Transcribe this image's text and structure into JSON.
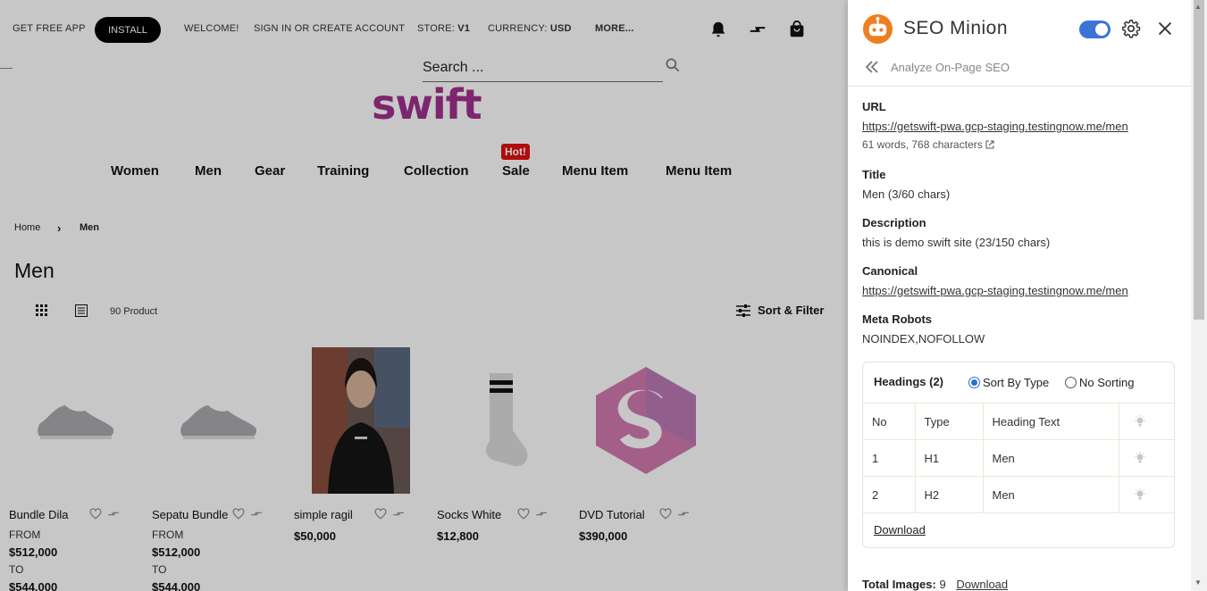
{
  "topbar": {
    "get_app": "GET FREE APP",
    "install": "INSTALL",
    "welcome": "WELCOME!",
    "signin": "SIGN IN OR CREATE ACCOUNT",
    "store_label": "STORE:",
    "store_value": "V1",
    "currency_label": "CURRENCY:",
    "currency_value": "USD",
    "more": "MORE..."
  },
  "search": {
    "placeholder": "Search ..."
  },
  "logo": "swift",
  "nav": {
    "items": [
      "Women",
      "Men",
      "Gear",
      "Training",
      "Collection",
      "Sale",
      "Menu Item",
      "Menu Item"
    ],
    "hot_badge": "Hot!"
  },
  "breadcrumb": {
    "home": "Home",
    "current": "Men"
  },
  "page_title": "Men",
  "toolbar": {
    "count": "90 Product",
    "sort_filter": "Sort & Filter"
  },
  "products": [
    {
      "name": "Bundle Dila",
      "from": "FROM",
      "price": "$512,000",
      "to": "TO",
      "price_to": "$544,000"
    },
    {
      "name": "Sepatu Bundle",
      "from": "FROM",
      "price": "$512,000",
      "to": "TO",
      "price_to": "$544,000"
    },
    {
      "name": "simple ragil",
      "price": "$50,000"
    },
    {
      "name": "Socks White",
      "price": "$12,800"
    },
    {
      "name": "DVD Tutorial",
      "price": "$390,000"
    }
  ],
  "panel": {
    "title": "SEO Minion",
    "subtitle": "Analyze On-Page SEO",
    "url_label": "URL",
    "url": "https://getswift-pwa.gcp-staging.testingnow.me/men",
    "url_stats": "61 words, 768 characters",
    "title_label": "Title",
    "title_value": "Men (3/60 chars)",
    "desc_label": "Description",
    "desc_value": "this is demo swift site (23/150 chars)",
    "canonical_label": "Canonical",
    "canonical": "https://getswift-pwa.gcp-staging.testingnow.me/men",
    "robots_label": "Meta Robots",
    "robots_value": "NOINDEX,NOFOLLOW",
    "headings": {
      "title": "Headings (2)",
      "sort_by_type": "Sort By Type",
      "no_sorting": "No Sorting",
      "columns": [
        "No",
        "Type",
        "Heading Text"
      ],
      "rows": [
        {
          "no": "1",
          "type": "H1",
          "text": "Men"
        },
        {
          "no": "2",
          "type": "H2",
          "text": "Men"
        }
      ],
      "download": "Download"
    },
    "total_images_label": "Total Images:",
    "total_images": "9",
    "images_download": "Download"
  },
  "colors": {
    "brand": "#a0308e",
    "toggle": "#3b74d6",
    "hot": "#e01010"
  }
}
